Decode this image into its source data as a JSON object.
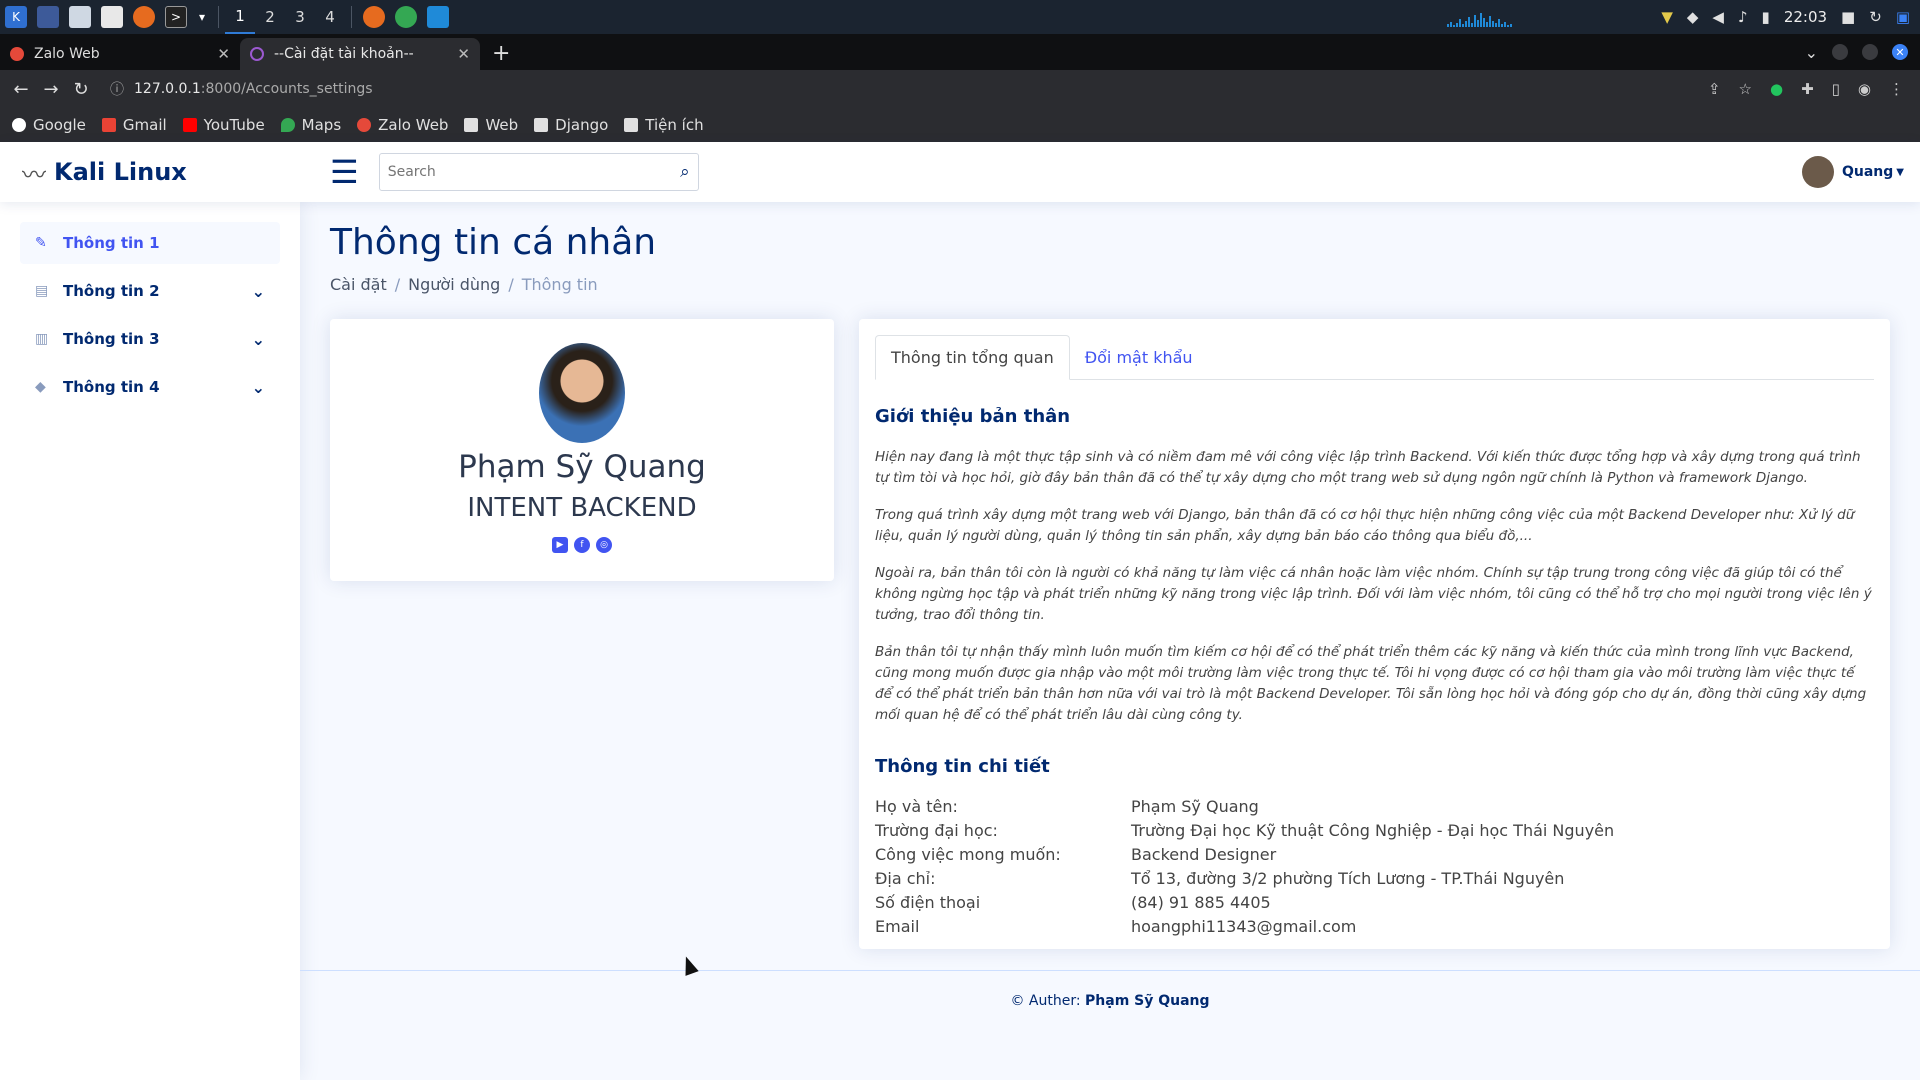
{
  "taskbar": {
    "workspaces": [
      "1",
      "2",
      "3",
      "4"
    ],
    "time": "22:03"
  },
  "browser": {
    "tabs": [
      {
        "title": "Zalo Web",
        "active": false
      },
      {
        "title": "--Cài đặt tài khoản--",
        "active": true
      }
    ],
    "url_host": "127.0.0.1",
    "url_path": ":8000/Accounts_settings",
    "bookmarks": [
      "Google",
      "Gmail",
      "YouTube",
      "Maps",
      "Zalo Web",
      "Web",
      "Django",
      "Tiện ích"
    ]
  },
  "header": {
    "logo": "Kali Linux",
    "search_placeholder": "Search",
    "user_name": "Quang"
  },
  "sidebar": {
    "items": [
      {
        "label": "Thông tin 1",
        "icon": "feather-icon"
      },
      {
        "label": "Thông tin 2",
        "icon": "document-icon"
      },
      {
        "label": "Thông tin 3",
        "icon": "bar-chart-icon"
      },
      {
        "label": "Thông tin 4",
        "icon": "gem-icon"
      }
    ]
  },
  "page": {
    "title": "Thông tin cá nhân",
    "breadcrumb": [
      "Cài đặt",
      "Người dùng",
      "Thông tin"
    ]
  },
  "profile": {
    "name": "Phạm Sỹ Quang",
    "role": "INTENT BACKEND"
  },
  "tabs": [
    "Thông tin tổng quan",
    "Đổi mật khẩu"
  ],
  "about": {
    "title": "Giới thiệu bản thân",
    "paragraphs": [
      "Hiện nay đang là một thực tập sinh và có niềm đam mê với công việc lập trình Backend. Với kiến thức được tổng hợp và xây dựng trong quá trình tự tìm tòi và học hỏi, giờ đây bản thân đã có thể tự xây dựng cho một trang web sử dụng ngôn ngữ chính là Python và framework Django.",
      "Trong quá trình xây dựng một trang web với Django, bản thân đã có cơ hội thực hiện những công việc của một Backend Developer như: Xử lý dữ liệu, quản lý người dùng, quản lý thông tin sản phẩn, xây dựng bản báo cáo thông qua biểu đồ,...",
      "Ngoài ra, bản thân tôi còn là người có khả năng tự làm việc cá nhân hoặc làm việc nhóm. Chính sự tập trung trong công việc đã giúp tôi có thể không ngừng học tập và phát triển những kỹ năng trong việc lập trình. Đối với làm việc nhóm, tôi cũng có thể hỗ trợ cho mọi người trong việc lên ý tưởng, trao đổi thông tin.",
      "Bản thân tôi tự nhận thấy mình luôn muốn tìm kiếm cơ hội để có thể phát triển thêm các kỹ năng và kiến thức của mình trong lĩnh vực Backend, cũng mong muốn được gia nhập vào một môi trường làm việc trong thực tế. Tôi hi vọng được có cơ hội tham gia vào môi trường làm việc thực tế để có thể phát triển bản thân hơn nữa với vai trò là một Backend Developer. Tôi sẵn lòng học hỏi và đóng góp cho dự án, đồng thời cũng xây dựng mối quan hệ để có thể phát triển lâu dài cùng công ty."
    ]
  },
  "details": {
    "title": "Thông tin chi tiết",
    "rows": [
      {
        "label": "Họ và tên:",
        "value": "Phạm Sỹ Quang"
      },
      {
        "label": "Trường đại học:",
        "value": "Trường Đại học Kỹ thuật Công Nghiệp - Đại học Thái Nguyên"
      },
      {
        "label": "Công việc mong muốn:",
        "value": "Backend Designer"
      },
      {
        "label": "Địa chỉ:",
        "value": "Tổ 13, đường 3/2 phường Tích Lương - TP.Thái Nguyên"
      },
      {
        "label": "Số điện thoại",
        "value": "(84) 91 885 4405"
      },
      {
        "label": "Email",
        "value": "hoangphi11343@gmail.com"
      }
    ]
  },
  "footer": {
    "prefix": "© Auther:",
    "author": "Phạm Sỹ Quang"
  }
}
